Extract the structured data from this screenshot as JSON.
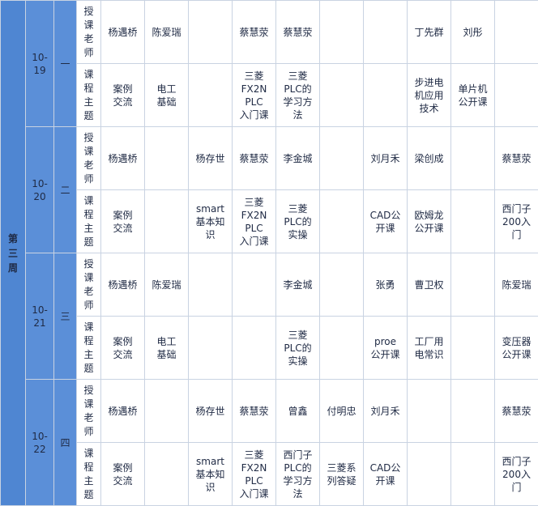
{
  "week": "第三周",
  "days": [
    {
      "date": "10-19",
      "dow": "一"
    },
    {
      "date": "10-20",
      "dow": "二"
    },
    {
      "date": "10-21",
      "dow": "三"
    },
    {
      "date": "10-22",
      "dow": "四"
    }
  ],
  "row_labels": {
    "teacher": "授课老师",
    "topic": "课程主题"
  },
  "teacher_rows": [
    [
      "杨遇桥",
      "陈爱瑞",
      "",
      "蔡慧荥",
      "蔡慧荥",
      "",
      "",
      "丁先群",
      "刘彤",
      ""
    ],
    [
      "杨遇桥",
      "",
      "杨存世",
      "蔡慧荥",
      "李金城",
      "",
      "刘月禾",
      "梁创成",
      "",
      "蔡慧荥"
    ],
    [
      "杨遇桥",
      "陈爱瑞",
      "",
      "",
      "李金城",
      "",
      "张勇",
      "曹卫权",
      "",
      "陈爱瑞"
    ],
    [
      "杨遇桥",
      "",
      "杨存世",
      "蔡慧荥",
      "曾鑫",
      "付明忠",
      "刘月禾",
      "",
      "",
      "蔡慧荥"
    ]
  ],
  "topic_rows": [
    [
      [
        "案例",
        "交流"
      ],
      [
        "电工",
        "基础"
      ],
      [],
      [
        "三菱",
        "FX2N",
        "PLC",
        "入门课"
      ],
      [
        "三菱",
        "PLC的",
        "学习方",
        "法"
      ],
      [],
      [],
      [
        "步进电",
        "机应用",
        "技术"
      ],
      [
        "单片机",
        "公开课"
      ],
      []
    ],
    [
      [
        "案例",
        "交流"
      ],
      [],
      [
        "smart",
        "基本知",
        "识"
      ],
      [
        "三菱",
        "FX2N",
        "PLC",
        "入门课"
      ],
      [
        "三菱",
        "PLC的",
        "实操"
      ],
      [],
      [
        "CAD公",
        "开课"
      ],
      [
        "欧姆龙",
        "公开课"
      ],
      [],
      [
        "西门子",
        "200入",
        "门"
      ]
    ],
    [
      [
        "案例",
        "交流"
      ],
      [
        "电工",
        "基础"
      ],
      [],
      [],
      [
        "三菱",
        "PLC的",
        "实操"
      ],
      [],
      [
        "proe",
        "公开课"
      ],
      [
        "工厂用",
        "电常识"
      ],
      [],
      [
        "变压器",
        "公开课"
      ]
    ],
    [
      [
        "案例",
        "交流"
      ],
      [],
      [
        "smart",
        "基本知",
        "识"
      ],
      [
        "三菱",
        "FX2N",
        "PLC",
        "入门课"
      ],
      [
        "西门子",
        "PLC的",
        "学习方",
        "法"
      ],
      [
        "三菱系",
        "列答疑"
      ],
      [
        "CAD公",
        "开课"
      ],
      [],
      [],
      [
        "西门子",
        "200入",
        "门"
      ]
    ]
  ]
}
